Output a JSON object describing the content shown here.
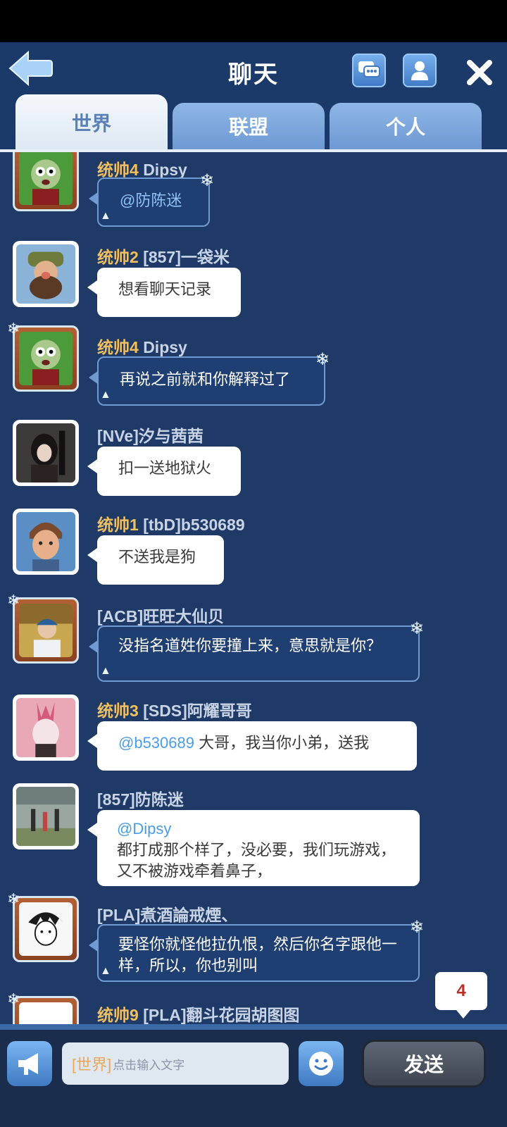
{
  "header": {
    "title": "聊天",
    "tabs": [
      "世界",
      "联盟",
      "个人"
    ],
    "active_tab": 0
  },
  "messages": [
    {
      "rank": "统帅4",
      "name": "Dipsy",
      "mention": "@防陈迷",
      "text": "",
      "style": "dark"
    },
    {
      "rank": "统帅2",
      "name": "[857]一袋米",
      "mention": "",
      "text": "想看聊天记录",
      "style": "light"
    },
    {
      "rank": "统帅4",
      "name": "Dipsy",
      "mention": "",
      "text": "再说之前就和你解释过了",
      "style": "dark"
    },
    {
      "rank": "",
      "name": "[NVe]汐与茜茜",
      "mention": "",
      "text": "扣一送地狱火",
      "style": "light"
    },
    {
      "rank": "统帅1",
      "name": "[tbD]b530689",
      "mention": "",
      "text": "不送我是狗",
      "style": "light"
    },
    {
      "rank": "",
      "name": "[ACB]旺旺大仙贝",
      "mention": "",
      "text": "没指名道姓你要撞上来，意思就是你？",
      "style": "dark"
    },
    {
      "rank": "统帅3",
      "name": "[SDS]阿耀哥哥",
      "mention": "@b530689",
      "text": " 大哥，我当你小弟，送我",
      "style": "light"
    },
    {
      "rank": "",
      "name": "[857]防陈迷",
      "mention": "@Dipsy",
      "text": "都打成那个样了，没必要，我们玩游戏，又不被游戏牵着鼻子，",
      "style": "light"
    },
    {
      "rank": "",
      "name": "[PLA]煮酒論戒煙、",
      "mention": "",
      "text": "要怪你就怪他拉仇恨，然后你名字跟他一样，所以，你也别叫",
      "style": "dark"
    },
    {
      "rank": "统帅9",
      "name": "[PLA]翻斗花园胡图图",
      "mention": "",
      "text": "",
      "style": "none"
    }
  ],
  "unread_badge": "4",
  "input": {
    "channel": "[世界]",
    "placeholder": "点击输入文字"
  },
  "send_label": "发送",
  "colors": {
    "background": "#1f3a66",
    "rank_gold": "#f1c05c",
    "mention_blue": "#4b9ce8"
  }
}
